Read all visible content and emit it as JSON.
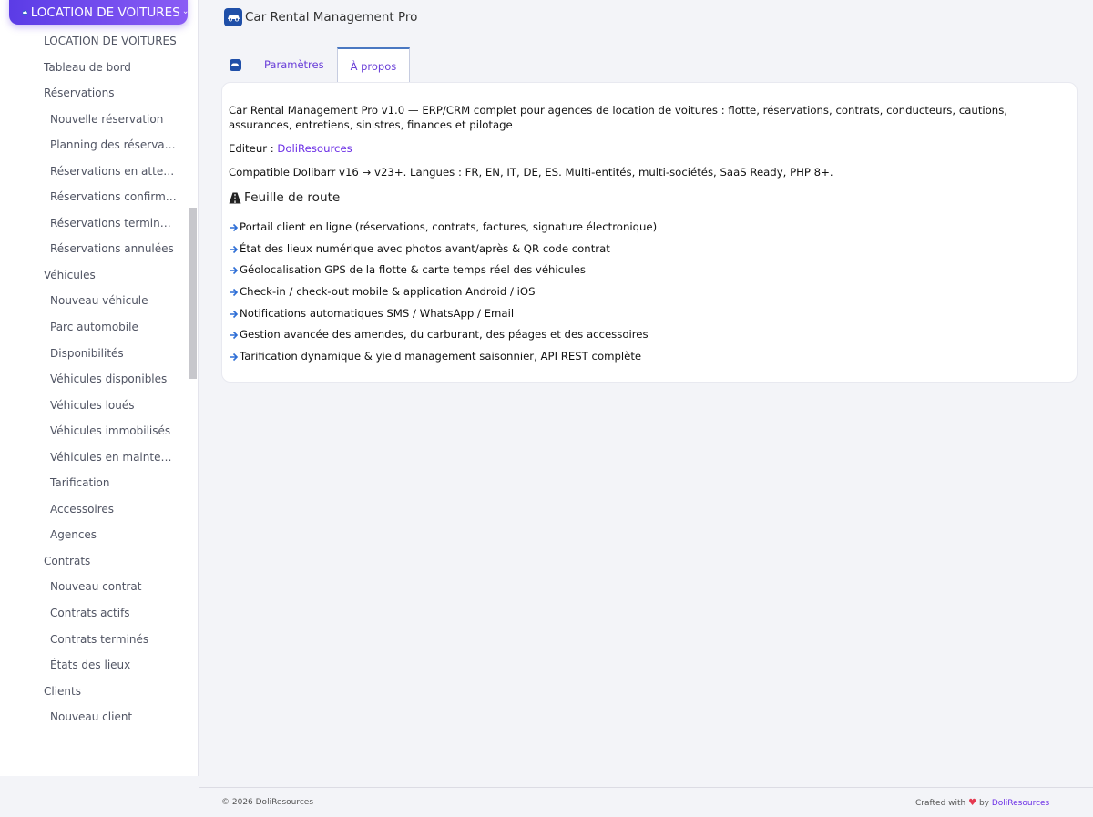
{
  "module_menu": {
    "label": "LOCATION DE VOITURES"
  },
  "sidebar": {
    "items": [
      {
        "label": "LOCATION DE VOITURES",
        "level": "top"
      },
      {
        "label": "Tableau de bord",
        "level": "top"
      },
      {
        "label": "Réservations",
        "level": "top"
      },
      {
        "label": "Nouvelle réservation",
        "level": "sub"
      },
      {
        "label": "Planning des réservations",
        "level": "sub"
      },
      {
        "label": "Réservations en attente",
        "level": "sub"
      },
      {
        "label": "Réservations confirmées",
        "level": "sub"
      },
      {
        "label": "Réservations terminées",
        "level": "sub"
      },
      {
        "label": "Réservations annulées",
        "level": "sub"
      },
      {
        "label": "Véhicules",
        "level": "top"
      },
      {
        "label": "Nouveau véhicule",
        "level": "sub"
      },
      {
        "label": "Parc automobile",
        "level": "sub"
      },
      {
        "label": "Disponibilités",
        "level": "sub"
      },
      {
        "label": "Véhicules disponibles",
        "level": "sub"
      },
      {
        "label": "Véhicules loués",
        "level": "sub"
      },
      {
        "label": "Véhicules immobilisés",
        "level": "sub"
      },
      {
        "label": "Véhicules en maintenance",
        "level": "sub"
      },
      {
        "label": "Tarification",
        "level": "sub"
      },
      {
        "label": "Accessoires",
        "level": "sub"
      },
      {
        "label": "Agences",
        "level": "sub"
      },
      {
        "label": "Contrats",
        "level": "top"
      },
      {
        "label": "Nouveau contrat",
        "level": "sub"
      },
      {
        "label": "Contrats actifs",
        "level": "sub"
      },
      {
        "label": "Contrats terminés",
        "level": "sub"
      },
      {
        "label": "États des lieux",
        "level": "sub"
      },
      {
        "label": "Clients",
        "level": "top"
      },
      {
        "label": "Nouveau client",
        "level": "sub"
      }
    ]
  },
  "header": {
    "title": "Car Rental Management Pro"
  },
  "tabs": [
    {
      "label": "Paramètres",
      "active": false
    },
    {
      "label": "À propos",
      "active": true
    }
  ],
  "about": {
    "description": "Car Rental Management Pro v1.0 — ERP/CRM complet pour agences de location de voitures : flotte, réservations, contrats, conducteurs, cautions, assurances, entretiens, sinistres, finances et pilotage",
    "editor_label": "Editeur : ",
    "editor_link": "DoliResources",
    "compat": "Compatible Dolibarr v16 → v23+. Langues : FR, EN, IT, DE, ES. Multi-entités, multi-sociétés, SaaS Ready, PHP 8+.",
    "roadmap_title": "Feuille de route",
    "roadmap": [
      "Portail client en ligne (réservations, contrats, factures, signature électronique)",
      "État des lieux numérique avec photos avant/après & QR code contrat",
      "Géolocalisation GPS de la flotte & carte temps réel des véhicules",
      "Check-in / check-out mobile & application Android / iOS",
      "Notifications automatiques SMS / WhatsApp / Email",
      "Gestion avancée des amendes, du carburant, des péages et des accessoires",
      "Tarification dynamique & yield management saisonnier, API REST complète"
    ]
  },
  "footer": {
    "copyright": "© 2026 DoliResources",
    "crafted_prefix": "Crafted with ",
    "crafted_by": " by ",
    "crafted_link": "DoliResources"
  },
  "colors": {
    "accent": "#6b2ee6",
    "arrow": "#2f6fd6",
    "heart": "#e53950"
  },
  "icons": {
    "module": "cloud-icon",
    "chevron": "chevron-down-icon",
    "logo": "car-logo-icon",
    "roadmap": "road-icon",
    "list": "arrow-right-icon",
    "heart": "heart-icon"
  }
}
